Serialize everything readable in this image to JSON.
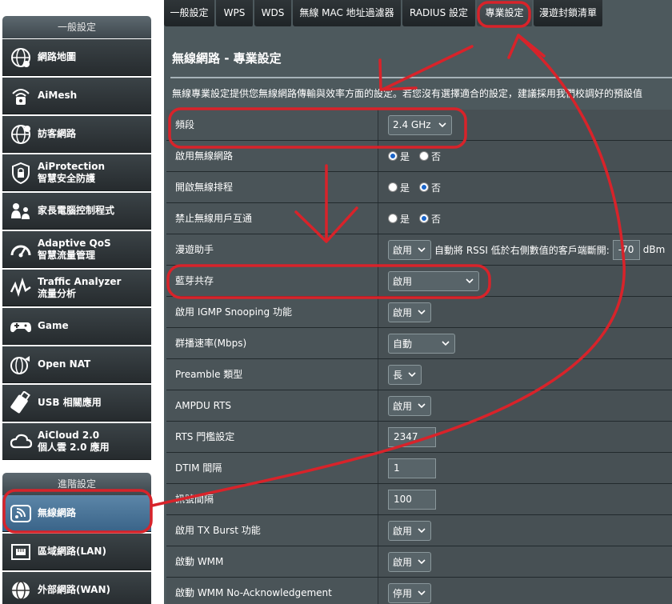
{
  "sidebar": {
    "general_header": "一般設定",
    "advanced_header": "進階設定",
    "general_items": [
      {
        "line1": "網路地圖",
        "line2": "",
        "icon": "globe-icon"
      },
      {
        "line1": "AiMesh",
        "line2": "",
        "icon": "aimesh-icon"
      },
      {
        "line1": "訪客網路",
        "line2": "",
        "icon": "guest-network-icon"
      },
      {
        "line1": "AiProtection",
        "line2": "智慧安全防護",
        "icon": "shield-lock-icon"
      },
      {
        "line1": "家長電腦控制程式",
        "line2": "",
        "icon": "parental-control-icon"
      },
      {
        "line1": "Adaptive QoS",
        "line2": "智慧流量管理",
        "icon": "gauge-icon"
      },
      {
        "line1": "Traffic Analyzer",
        "line2": "流量分析",
        "icon": "traffic-chart-icon"
      },
      {
        "line1": "Game",
        "line2": "",
        "icon": "gamepad-icon"
      },
      {
        "line1": "Open NAT",
        "line2": "",
        "icon": "open-nat-icon"
      },
      {
        "line1": "USB 相關應用",
        "line2": "",
        "icon": "usb-icon"
      },
      {
        "line1": "AiCloud 2.0",
        "line2": "個人雲 2.0 應用",
        "icon": "cloud-icon"
      }
    ],
    "advanced_items": [
      {
        "line1": "無線網路",
        "line2": "",
        "icon": "wireless-icon"
      },
      {
        "line1": "區域網路(LAN)",
        "line2": "",
        "icon": "lan-icon"
      },
      {
        "line1": "外部網路(WAN)",
        "line2": "",
        "icon": "wan-globe-icon"
      }
    ]
  },
  "tabs": [
    "一般設定",
    "WPS",
    "WDS",
    "無線 MAC 地址過濾器",
    "RADIUS 設定",
    "專業設定",
    "漫遊封鎖清單"
  ],
  "page": {
    "title": "無線網路 - 專業設定",
    "description": "無線專業設定提供您無線網路傳輸與效率方面的設定。若您沒有選擇適合的設定，建議採用我們校調好的預設值"
  },
  "settings": {
    "band": {
      "label": "頻段",
      "value": "2.4 GHz"
    },
    "enable_radio": {
      "label": "啟用無線網路",
      "yes": "是",
      "no": "否"
    },
    "schedule": {
      "label": "開啟無線排程",
      "yes": "是",
      "no": "否"
    },
    "ap_isolation": {
      "label": "禁止無線用戶互通",
      "yes": "是",
      "no": "否"
    },
    "roaming": {
      "label": "漫遊助手",
      "value": "啟用",
      "text": "自動將 RSSI 低於右側數值的客戶端斷開:",
      "rssi": "-70",
      "unit": "dBm"
    },
    "bt_coexist": {
      "label": "藍芽共存",
      "value": "啟用"
    },
    "igmp": {
      "label": "啟用 IGMP Snooping 功能",
      "value": "啟用"
    },
    "multicast": {
      "label": "群播速率(Mbps)",
      "value": "自動"
    },
    "preamble": {
      "label": "Preamble 類型",
      "value": "長"
    },
    "ampdu": {
      "label": "AMPDU RTS",
      "value": "啟用"
    },
    "rts": {
      "label": "RTS 門檻設定",
      "value": "2347"
    },
    "dtim": {
      "label": "DTIM 間隔",
      "value": "1"
    },
    "beacon": {
      "label": "訊號間隔",
      "value": "100"
    },
    "txburst": {
      "label": "啟用 TX Burst 功能",
      "value": "啟用"
    },
    "wmm": {
      "label": "啟動 WMM",
      "value": "啟用"
    },
    "wmm_noack": {
      "label": "啟動 WMM No-Acknowledgement",
      "value": "停用"
    }
  },
  "colors": {
    "annotation": "#d8232a",
    "active_nav": "#3a6489",
    "panel": "#4d595d"
  }
}
